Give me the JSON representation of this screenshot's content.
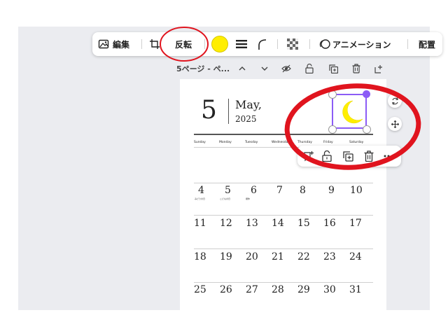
{
  "toolbar": {
    "edit_label": "編集",
    "flip_label": "反転",
    "color_swatch": "#ffee00",
    "animate_label": "アニメーション",
    "arrange_label": "配置"
  },
  "page_bar": {
    "page_label": "5ページ - ペ..."
  },
  "calendar": {
    "month_number": "5",
    "month_name": "May,",
    "year": "2025",
    "day_headers": [
      "Sunday",
      "Monday",
      "Tuesday",
      "Wednesday",
      "Thursday",
      "Friday",
      "Saturday"
    ],
    "week2": [
      "4",
      "5",
      "6",
      "7",
      "8",
      "9",
      "10"
    ],
    "week2_notes": [
      "みどりの日",
      "こどもの日",
      "振休"
    ],
    "week3": [
      "11",
      "12",
      "13",
      "14",
      "15",
      "16",
      "17"
    ],
    "week4": [
      "18",
      "19",
      "20",
      "21",
      "22",
      "23",
      "24"
    ],
    "week5": [
      "25",
      "26",
      "27",
      "28",
      "29",
      "30",
      "31"
    ]
  },
  "moon_element": {
    "color": "#ffee00",
    "selection_color": "#8b5cf6"
  },
  "annotations": {
    "color": "#e0141e"
  }
}
